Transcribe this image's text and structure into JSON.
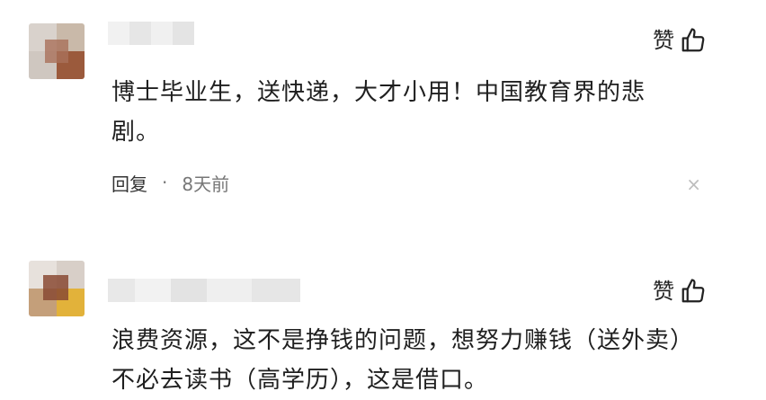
{
  "comments": [
    {
      "like_label": "赞",
      "text": "博士毕业生，送快递，大才小用！中国教育界的悲剧。",
      "reply_label": "回复",
      "separator": "·",
      "time": "8天前",
      "close_glyph": "×"
    },
    {
      "like_label": "赞",
      "text": "浪费资源，这不是挣钱的问题，想努力赚钱（送外卖）不必去读书（高学历），这是借口。"
    }
  ],
  "icons": {
    "like": "thumbs-up-icon",
    "close": "close-icon"
  }
}
